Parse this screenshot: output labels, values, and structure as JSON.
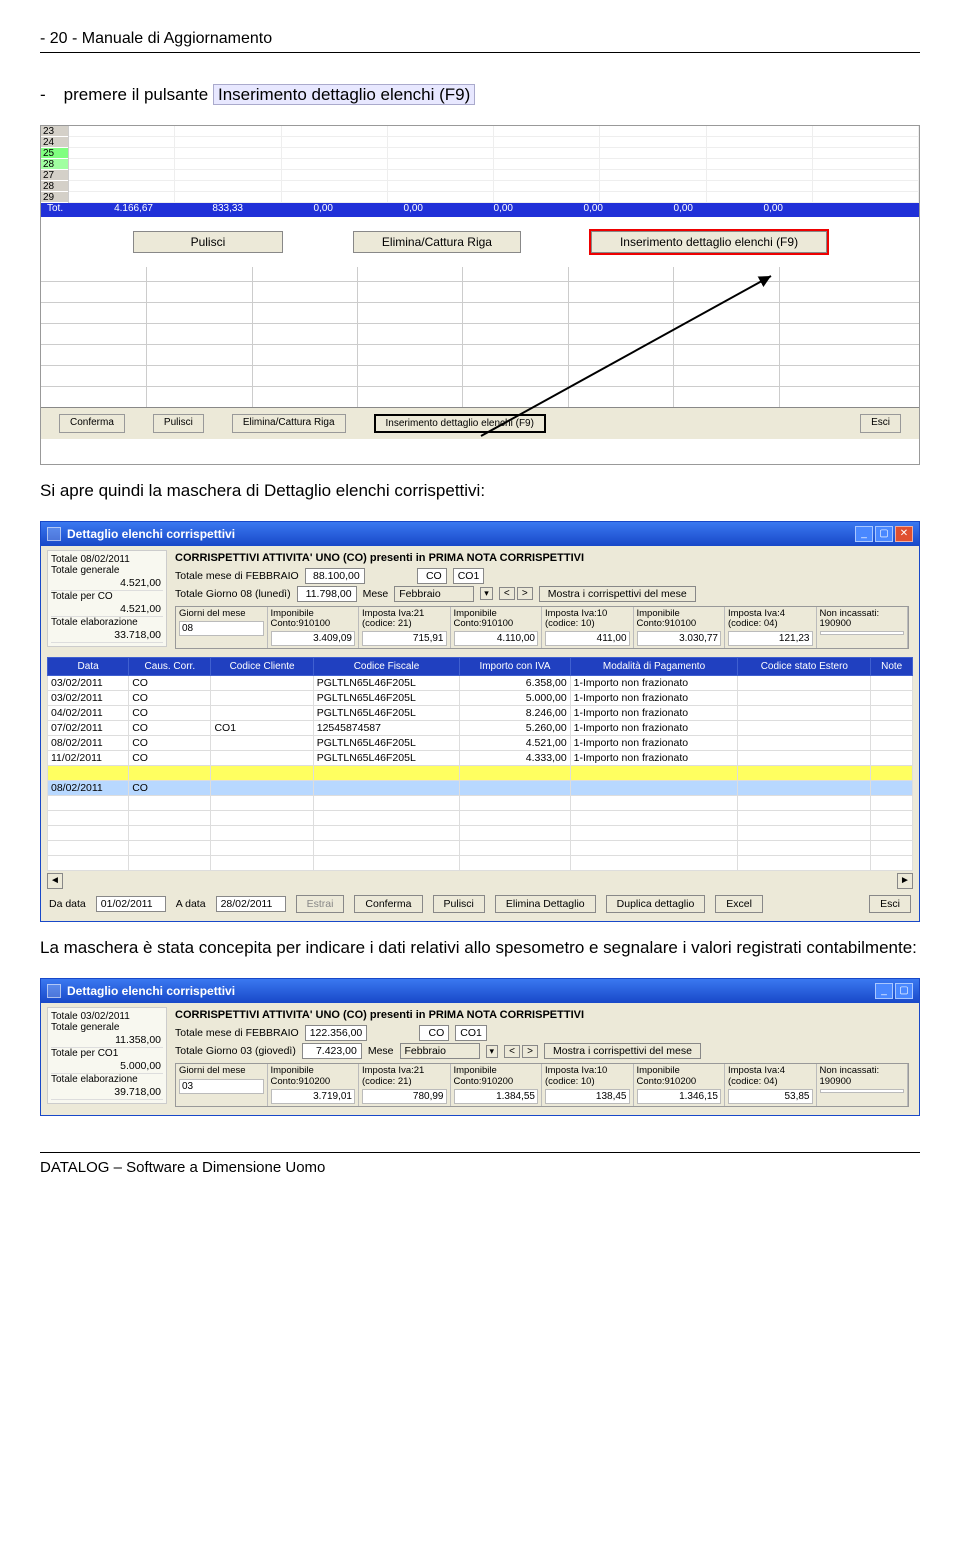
{
  "page_header": "- 20 -  Manuale di Aggiornamento",
  "intro_line_prefix": "-",
  "intro_line_text": "premere il pulsante",
  "intro_highlight": "Inserimento dettaglio elenchi (F9)",
  "shot1": {
    "rownums": [
      "23",
      "24",
      "25",
      "28",
      "27",
      "28",
      "29"
    ],
    "tot_label": "Tot.",
    "tot_values": [
      "4.166,67",
      "833,33",
      "0,00",
      "0,00",
      "0,00",
      "0,00",
      "0,00",
      "0,00"
    ],
    "buttons": {
      "pulisci": "Pulisci",
      "elimina": "Elimina/Cattura Riga",
      "inserimento": "Inserimento dettaglio elenchi (F9)"
    },
    "bottom": {
      "conferma": "Conferma",
      "pulisci": "Pulisci",
      "elimina": "Elimina/Cattura Riga",
      "inserimento": "Inserimento dettaglio elenchi (F9)",
      "esci": "Esci"
    }
  },
  "mid_text": "Si apre quindi la maschera di Dettaglio elenchi corrispettivi:",
  "win1": {
    "title": "Dettaglio elenchi corrispettivi",
    "left": {
      "l1": "Totale 08/02/2011",
      "v1": "",
      "l2": "Totale generale",
      "v2": "4.521,00",
      "l3": "Totale per CO",
      "v3": "4.521,00",
      "l4": "Totale elaborazione",
      "v4": "33.718,00"
    },
    "heading": "CORRISPETTIVI ATTIVITA' UNO   (CO)   presenti in PRIMA NOTA  CORRISPETTIVI",
    "row1": {
      "lab1": "Totale mese di FEBBRAIO",
      "v1": "88.100,00",
      "co_a": "CO",
      "co_b": "CO1"
    },
    "row2": {
      "lab1": "Totale Giorno 08 (lunedì)",
      "v1": "11.798,00",
      "lab2": "Mese",
      "v2": "Febbraio",
      "btn": "Mostra i corrispettivi del mese"
    },
    "stats": [
      {
        "h": "Giorni del mese",
        "a": "08",
        "b": ""
      },
      {
        "h": "Imponibile Conto:910100",
        "a": "",
        "b": "3.409,09"
      },
      {
        "h": "Imposta Iva:21 (codice: 21)",
        "a": "",
        "b": "715,91"
      },
      {
        "h": "Imponibile Conto:910100",
        "a": "",
        "b": "4.110,00"
      },
      {
        "h": "Imposta Iva:10 (codice: 10)",
        "a": "",
        "b": "411,00"
      },
      {
        "h": "Imponibile Conto:910100",
        "a": "",
        "b": "3.030,77"
      },
      {
        "h": "Imposta Iva:4 (codice: 04)",
        "a": "",
        "b": "121,23"
      },
      {
        "h": "Non incassati: 190900",
        "a": "",
        "b": ""
      }
    ],
    "cols": [
      "Data",
      "Caus. Corr.",
      "Codice Cliente",
      "Codice Fiscale",
      "Importo con IVA",
      "Modalità di Pagamento",
      "Codice stato Estero",
      "Note"
    ],
    "rows": [
      [
        "03/02/2011",
        "CO",
        "",
        "PGLTLN65L46F205L",
        "6.358,00",
        "1-Importo non frazionato",
        "",
        ""
      ],
      [
        "03/02/2011",
        "CO",
        "",
        "PGLTLN65L46F205L",
        "5.000,00",
        "1-Importo non frazionato",
        "",
        ""
      ],
      [
        "04/02/2011",
        "CO",
        "",
        "PGLTLN65L46F205L",
        "8.246,00",
        "1-Importo non frazionato",
        "",
        ""
      ],
      [
        "07/02/2011",
        "CO",
        "CO1",
        "12545874587",
        "5.260,00",
        "1-Importo non frazionato",
        "",
        ""
      ],
      [
        "08/02/2011",
        "CO",
        "",
        "PGLTLN65L46F205L",
        "4.521,00",
        "1-Importo non frazionato",
        "",
        ""
      ],
      [
        "11/02/2011",
        "CO",
        "",
        "PGLTLN65L46F205L",
        "4.333,00",
        "1-Importo non frazionato",
        "",
        ""
      ]
    ],
    "row_sel": [
      "08/02/2011",
      "CO",
      "",
      "",
      "",
      "",
      "",
      ""
    ],
    "bottom": {
      "lab_da": "Da data",
      "v_da": "01/02/2011",
      "lab_a": "A data",
      "v_a": "28/02/2011",
      "estrai": "Estrai",
      "conferma": "Conferma",
      "pulisci": "Pulisci",
      "elimina": "Elimina Dettaglio",
      "duplica": "Duplica dettaglio",
      "excel": "Excel",
      "esci": "Esci"
    }
  },
  "after_text": "La maschera è stata concepita per indicare i dati relativi allo spesometro e segnalare i valori registrati contabilmente:",
  "win2": {
    "title": "Dettaglio elenchi corrispettivi",
    "left": {
      "l1": "Totale 03/02/2011",
      "v1": "",
      "l2": "Totale generale",
      "v2": "11.358,00",
      "l3": "Totale per CO1",
      "v3": "5.000,00",
      "l4": "Totale elaborazione",
      "v4": "39.718,00"
    },
    "heading": "CORRISPETTIVI ATTIVITA' UNO   (CO)   presenti in PRIMA NOTA  CORRISPETTIVI",
    "row1": {
      "lab1": "Totale mese di FEBBRAIO",
      "v1": "122.356,00",
      "co_a": "CO",
      "co_b": "CO1"
    },
    "row2": {
      "lab1": "Totale Giorno 03 (giovedì)",
      "v1": "7.423,00",
      "lab2": "Mese",
      "v2": "Febbraio",
      "btn": "Mostra i corrispettivi del mese"
    },
    "stats": [
      {
        "h": "Giorni del mese",
        "a": "03",
        "b": ""
      },
      {
        "h": "Imponibile Conto:910200",
        "a": "",
        "b": "3.719,01"
      },
      {
        "h": "Imposta Iva:21 (codice: 21)",
        "a": "",
        "b": "780,99"
      },
      {
        "h": "Imponibile Conto:910200",
        "a": "",
        "b": "1.384,55"
      },
      {
        "h": "Imposta Iva:10 (codice: 10)",
        "a": "",
        "b": "138,45"
      },
      {
        "h": "Imponibile Conto:910200",
        "a": "",
        "b": "1.346,15"
      },
      {
        "h": "Imposta Iva:4 (codice: 04)",
        "a": "",
        "b": "53,85"
      },
      {
        "h": "Non incassati: 190900",
        "a": "",
        "b": ""
      }
    ]
  },
  "footer": "DATALOG – Software a Dimensione Uomo"
}
